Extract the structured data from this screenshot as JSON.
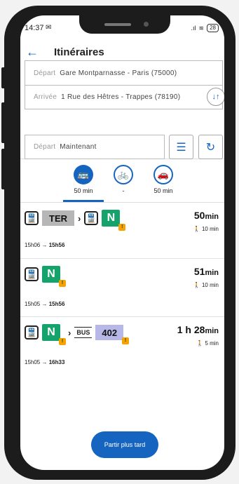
{
  "status": {
    "time": "14:37",
    "mail": "✉",
    "signal": ".ıl",
    "wifi": "≋",
    "battery": "28"
  },
  "header": {
    "back": "←",
    "title": "Itinéraires"
  },
  "fields": {
    "depart_label": "Départ",
    "depart_value": "Gare Montparnasse - Paris (75000)",
    "arrivee_label": "Arrivée",
    "arrivee_value": "1 Rue des Hêtres - Trappes (78190)",
    "time_label": "Départ",
    "time_value": "Maintenant"
  },
  "icons": {
    "swap": "↓↑",
    "filter": "☰",
    "refresh": "↻"
  },
  "modes": [
    {
      "name": "transit",
      "label": "50 min",
      "icon": "🚌"
    },
    {
      "name": "bike",
      "label": "-",
      "icon": "🚲"
    },
    {
      "name": "car",
      "label": "50 min",
      "icon": "🚗"
    }
  ],
  "routes": [
    {
      "duration": "50",
      "unit": "min",
      "walk": "10 min",
      "dep": "15h06",
      "arr": "15h56",
      "ter": "TER",
      "n": "N"
    },
    {
      "duration": "51",
      "unit": "min",
      "walk": "10 min",
      "dep": "15h05",
      "arr": "15h56",
      "n": "N"
    },
    {
      "duration_h": "1 h 28",
      "unit": "min",
      "walk": "5 min",
      "dep": "15h05",
      "arr": "16h33",
      "n": "N",
      "bus_word": "BUS",
      "bus_num": "402"
    }
  ],
  "buttons": {
    "later": "Partir plus tard"
  },
  "colors": {
    "accent": "#1565c0",
    "ligne_n": "#16a36b",
    "ter": "#b6b6b6",
    "bus402": "#b8b8e8",
    "warning": "#f4a300"
  }
}
